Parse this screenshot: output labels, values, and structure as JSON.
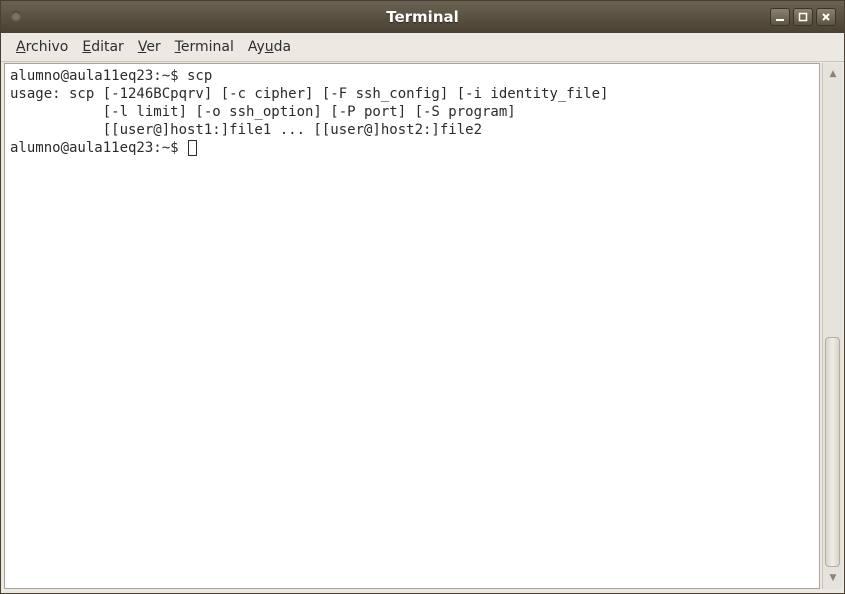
{
  "window": {
    "title": "Terminal"
  },
  "menu": [
    {
      "pre": "",
      "mnemonic": "A",
      "post": "rchivo"
    },
    {
      "pre": "",
      "mnemonic": "E",
      "post": "ditar"
    },
    {
      "pre": "",
      "mnemonic": "V",
      "post": "er"
    },
    {
      "pre": "",
      "mnemonic": "T",
      "post": "erminal"
    },
    {
      "pre": "Ay",
      "mnemonic": "u",
      "post": "da"
    }
  ],
  "terminal": {
    "lines": [
      "alumno@aula11eq23:~$ scp",
      "usage: scp [-1246BCpqrv] [-c cipher] [-F ssh_config] [-i identity_file]",
      "           [-l limit] [-o ssh_option] [-P port] [-S program]",
      "           [[user@]host1:]file1 ... [[user@]host2:]file2"
    ],
    "prompt": "alumno@aula11eq23:~$ "
  },
  "icons": {
    "window_menu": "window-menu-icon",
    "minimize": "minimize-icon",
    "maximize": "maximize-icon",
    "close": "close-icon",
    "scroll_up": "arrow-up-icon",
    "scroll_down": "arrow-down-icon"
  },
  "colors": {
    "titlebar": "#5a5043",
    "terminal_bg": "#ffffff",
    "terminal_fg": "#2b2b2b"
  }
}
